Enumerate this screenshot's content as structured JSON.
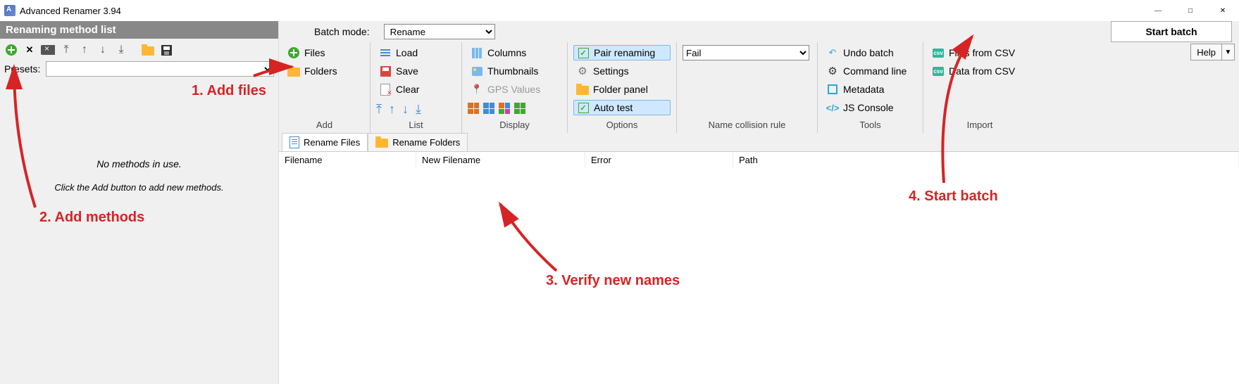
{
  "window": {
    "title": "Advanced Renamer 3.94"
  },
  "left": {
    "header": "Renaming method list",
    "presets_label": "Presets:",
    "empty_line1": "No methods in use.",
    "empty_line2": "Click the Add button to add new methods."
  },
  "batch": {
    "label": "Batch mode:",
    "selected": "Rename"
  },
  "start_button": "Start batch",
  "help_button": "Help",
  "ribbon": {
    "add": {
      "caption": "Add",
      "files": "Files",
      "folders": "Folders"
    },
    "list": {
      "caption": "List",
      "load": "Load",
      "save": "Save",
      "clear": "Clear"
    },
    "display": {
      "caption": "Display",
      "columns": "Columns",
      "thumbnails": "Thumbnails",
      "gps": "GPS Values"
    },
    "options": {
      "caption": "Options",
      "pair": "Pair renaming",
      "settings": "Settings",
      "folder_panel": "Folder panel",
      "auto_test": "Auto test"
    },
    "collision": {
      "caption": "Name collision rule",
      "selected": "Fail"
    },
    "tools": {
      "caption": "Tools",
      "undo": "Undo batch",
      "cmd": "Command line",
      "metadata": "Metadata",
      "js": "JS Console"
    },
    "import": {
      "caption": "Import",
      "files_csv": "Files from CSV",
      "data_csv": "Data from CSV"
    }
  },
  "tabs": {
    "rename_files": "Rename Files",
    "rename_folders": "Rename Folders"
  },
  "table": {
    "col_filename": "Filename",
    "col_new": "New Filename",
    "col_error": "Error",
    "col_path": "Path"
  },
  "annotations": {
    "a1": "1. Add files",
    "a2": "2. Add methods",
    "a3": "3. Verify new names",
    "a4": "4. Start batch"
  }
}
